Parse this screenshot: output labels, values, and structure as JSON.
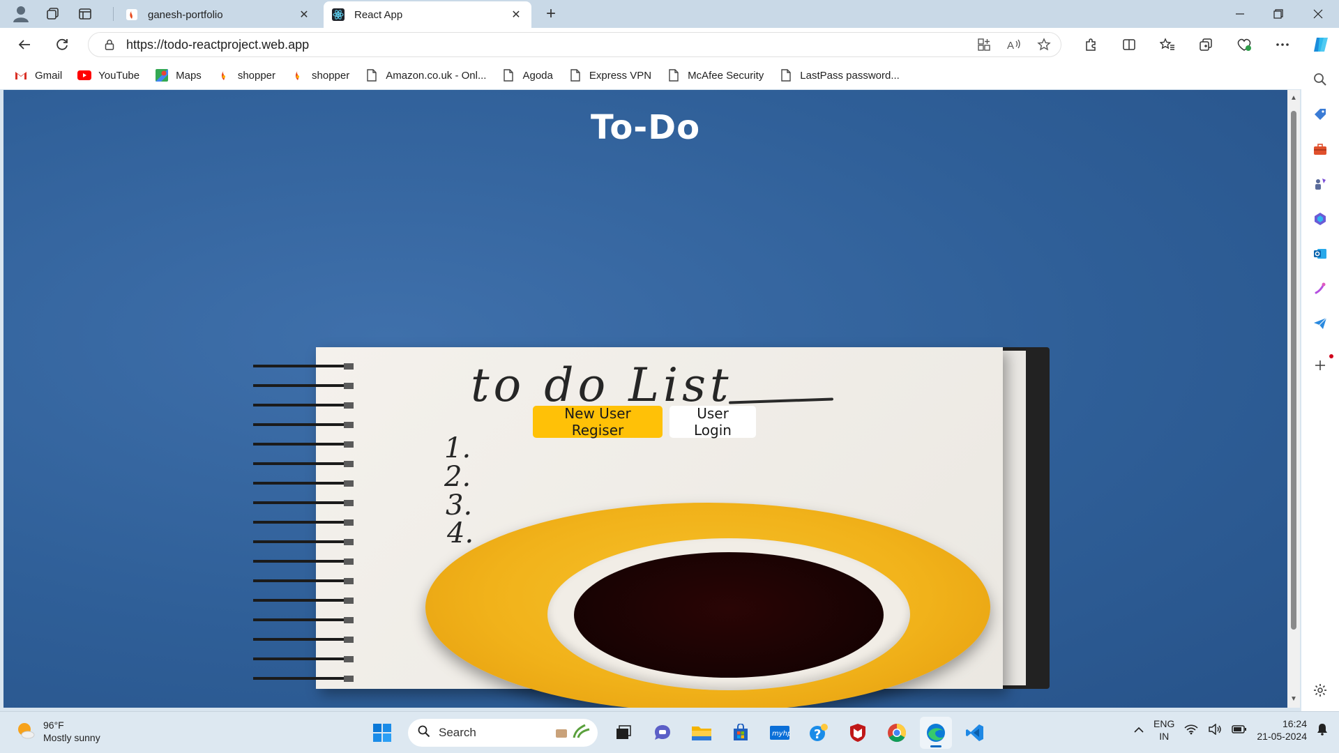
{
  "browser": {
    "tabs": [
      {
        "title": "ganesh-portfolio",
        "icon": "portfolio-favicon"
      },
      {
        "title": "React App",
        "icon": "react-favicon"
      }
    ],
    "url": "https://todo-reactproject.web.app",
    "bookmarks": [
      {
        "label": "Gmail",
        "icon": "gmail-icon"
      },
      {
        "label": "YouTube",
        "icon": "youtube-icon"
      },
      {
        "label": "Maps",
        "icon": "maps-icon"
      },
      {
        "label": "shopper",
        "icon": "shopper-icon"
      },
      {
        "label": "shopper",
        "icon": "shopper-icon"
      },
      {
        "label": "Amazon.co.uk - Onl...",
        "icon": "page-icon"
      },
      {
        "label": "Agoda",
        "icon": "page-icon"
      },
      {
        "label": "Express VPN",
        "icon": "page-icon"
      },
      {
        "label": "McAfee Security",
        "icon": "page-icon"
      },
      {
        "label": "LastPass password...",
        "icon": "page-icon"
      }
    ]
  },
  "page": {
    "title": "To-Do",
    "notebook_heading": "to do List",
    "notebook_numbers": [
      "1.",
      "2.",
      "3.",
      "4."
    ],
    "register_button": "New User Regiser",
    "login_button": "User Login"
  },
  "colors": {
    "background": "#2f5f98",
    "register_button": "#ffc107",
    "login_button": "#ffffff",
    "saucer": "#f1b21a"
  },
  "taskbar": {
    "weather_temp": "96°F",
    "weather_desc": "Mostly sunny",
    "search_placeholder": "Search",
    "lang_top": "ENG",
    "lang_bottom": "IN",
    "time": "16:24",
    "date": "21-05-2024"
  }
}
